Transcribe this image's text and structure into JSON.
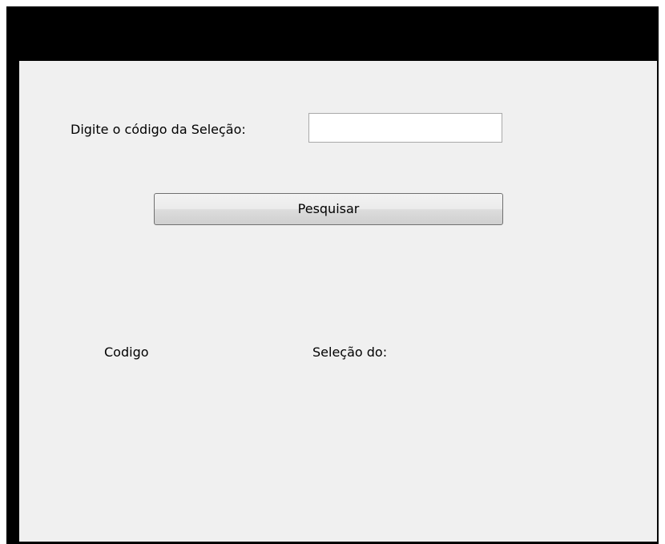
{
  "form": {
    "prompt_label": "Digite o código da Seleção:",
    "code_input": {
      "value": "",
      "placeholder": ""
    },
    "search_button_label": "Pesquisar"
  },
  "results": {
    "codigo_label": "Codigo",
    "selecao_label": "Seleção do:"
  },
  "colors": {
    "window_frame": "#000000",
    "client_background": "#f0f0f0",
    "input_border": "#a9a9a9",
    "button_border": "#707070"
  }
}
